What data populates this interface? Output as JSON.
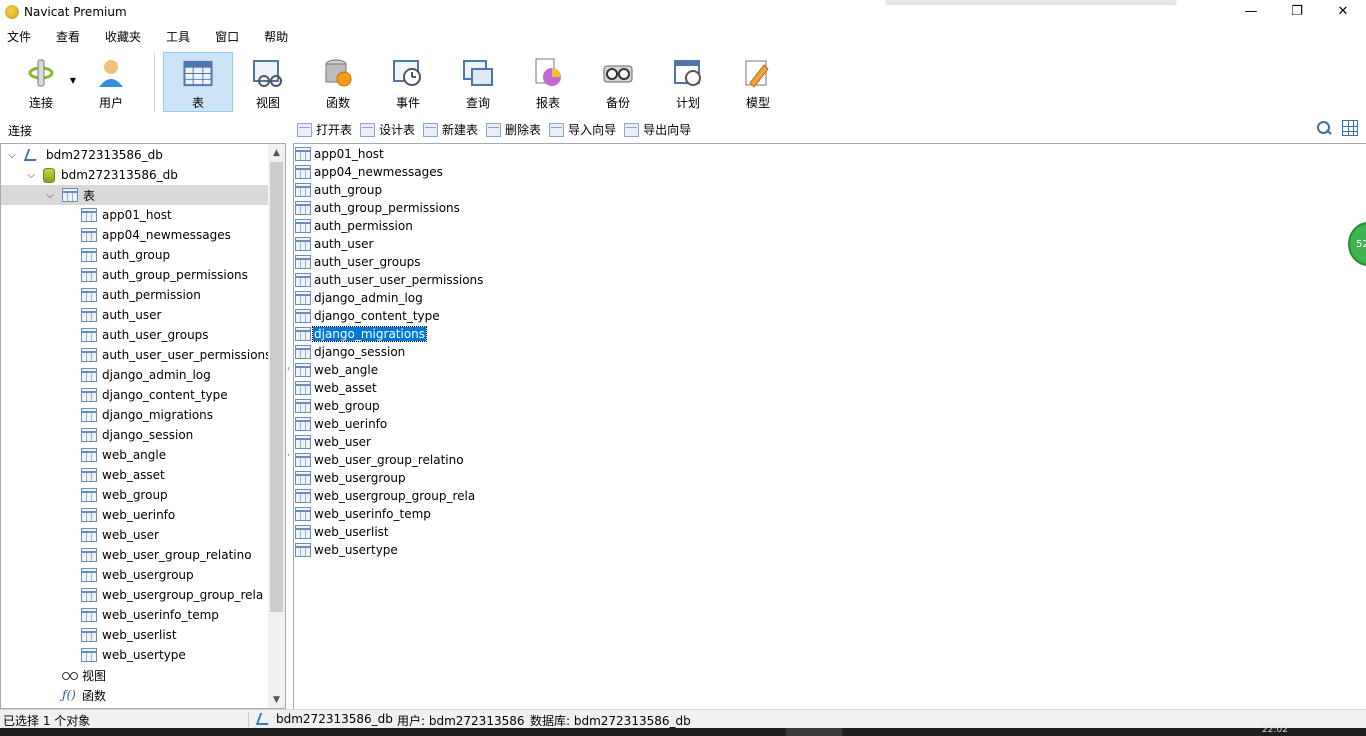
{
  "window": {
    "title": "Navicat Premium",
    "minimize": "—",
    "maximize": "❐",
    "close": "✕"
  },
  "menu": [
    "文件",
    "查看",
    "收藏夹",
    "工具",
    "窗口",
    "帮助"
  ],
  "toolbar": [
    {
      "label": "连接",
      "icon": "connection-icon"
    },
    {
      "label": "用户",
      "icon": "user-icon"
    },
    {
      "label": "表",
      "icon": "table-icon",
      "active": true
    },
    {
      "label": "视图",
      "icon": "view-icon"
    },
    {
      "label": "函数",
      "icon": "function-icon"
    },
    {
      "label": "事件",
      "icon": "event-icon"
    },
    {
      "label": "查询",
      "icon": "query-icon"
    },
    {
      "label": "报表",
      "icon": "report-icon"
    },
    {
      "label": "备份",
      "icon": "backup-icon"
    },
    {
      "label": "计划",
      "icon": "schedule-icon"
    },
    {
      "label": "模型",
      "icon": "model-icon"
    }
  ],
  "subbar": {
    "connection_label": "连接",
    "object_tools": [
      "打开表",
      "设计表",
      "新建表",
      "删除表",
      "导入向导",
      "导出向导"
    ]
  },
  "tree": {
    "connection": "bdm272313586_db",
    "database": "bdm272313586_db",
    "tables_node": "表",
    "views_node": "视图",
    "functions_node": "函数"
  },
  "tables": [
    "app01_host",
    "app04_newmessages",
    "auth_group",
    "auth_group_permissions",
    "auth_permission",
    "auth_user",
    "auth_user_groups",
    "auth_user_user_permissions",
    "django_admin_log",
    "django_content_type",
    "django_migrations",
    "django_session",
    "web_angle",
    "web_asset",
    "web_group",
    "web_uerinfo",
    "web_user",
    "web_user_group_relatino",
    "web_usergroup",
    "web_usergroup_group_rela",
    "web_userinfo_temp",
    "web_userlist",
    "web_usertype"
  ],
  "selected_table": "django_migrations",
  "side_badge": "52",
  "status": {
    "selection": "已选择 1 个对象",
    "connection": "bdm272313586_db",
    "user": "用户: bdm272313586",
    "database": "数据库: bdm272313586_db"
  },
  "taskbar": {
    "time": "22:02"
  }
}
